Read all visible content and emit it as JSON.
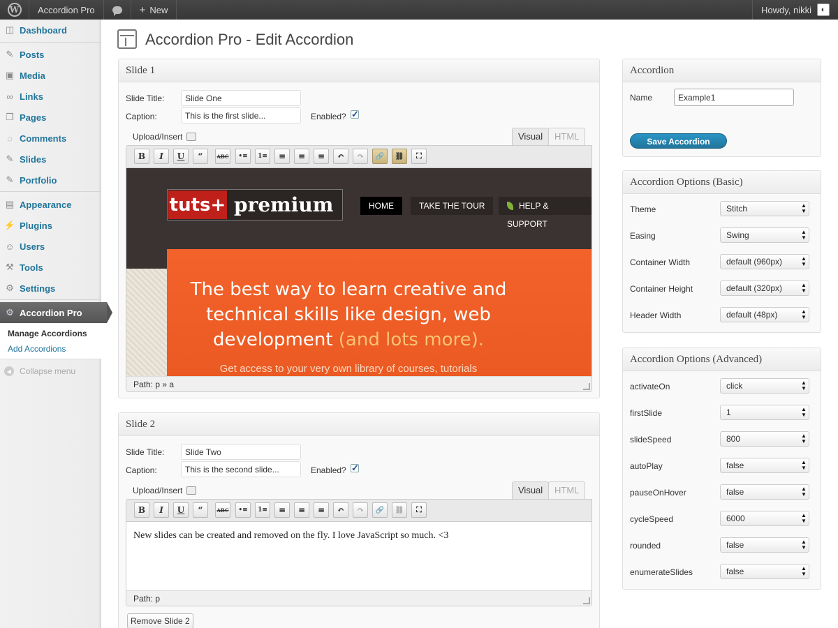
{
  "admin_bar": {
    "site_name": "Accordion Pro",
    "new_label": "New",
    "howdy": "Howdy, nikki"
  },
  "sidebar": {
    "items": [
      {
        "label": "Dashboard",
        "icon": "dashboard-icon"
      },
      {
        "label": "Posts",
        "icon": "pin-icon"
      },
      {
        "label": "Media",
        "icon": "media-icon"
      },
      {
        "label": "Links",
        "icon": "links-icon"
      },
      {
        "label": "Pages",
        "icon": "pages-icon"
      },
      {
        "label": "Comments",
        "icon": "comments-icon"
      },
      {
        "label": "Slides",
        "icon": "pin-icon"
      },
      {
        "label": "Portfolio",
        "icon": "pin-icon"
      },
      {
        "label": "Appearance",
        "icon": "appearance-icon"
      },
      {
        "label": "Plugins",
        "icon": "plugins-icon"
      },
      {
        "label": "Users",
        "icon": "users-icon"
      },
      {
        "label": "Tools",
        "icon": "tools-icon"
      },
      {
        "label": "Settings",
        "icon": "settings-icon"
      },
      {
        "label": "Accordion Pro",
        "icon": "gear-icon"
      }
    ],
    "submenu": [
      "Manage Accordions",
      "Add Accordions"
    ],
    "collapse": "Collapse menu"
  },
  "page": {
    "title": "Accordion Pro - Edit Accordion"
  },
  "slides": [
    {
      "heading": "Slide 1",
      "title_label": "Slide Title:",
      "title_value": "Slide One",
      "caption_label": "Caption:",
      "caption_value": "This is the first slide...",
      "enabled_label": "Enabled?",
      "upload_label": "Upload/Insert",
      "tab_visual": "Visual",
      "tab_html": "HTML",
      "path": "Path: p » a",
      "preview": {
        "logo_left": "tuts+",
        "logo_right": "premium",
        "nav": [
          "HOME",
          "TAKE THE TOUR",
          "HELP & SUPPORT"
        ],
        "headline_1": "The best way to learn creative and",
        "headline_2": "technical skills like design, web",
        "headline_3": "development",
        "headline_highlight": "(and lots more).",
        "subline": "Get access to your very own library of courses, tutorials"
      }
    },
    {
      "heading": "Slide 2",
      "title_label": "Slide Title:",
      "title_value": "Slide Two",
      "caption_label": "Caption:",
      "caption_value": "This is the second slide...",
      "enabled_label": "Enabled?",
      "upload_label": "Upload/Insert",
      "tab_visual": "Visual",
      "tab_html": "HTML",
      "body_text": "New slides can be created and removed on the fly.  I love JavaScript so much. <3",
      "path": "Path: p",
      "remove_label": "Remove Slide 2"
    }
  ],
  "toolbar_buttons": [
    "B",
    "I",
    "U",
    "“",
    "ABC",
    "•≡",
    "1≡",
    "≡",
    "≡",
    "≡",
    "↶",
    "↷",
    "🔗",
    "⛓",
    "⛶"
  ],
  "accordion_box": {
    "heading": "Accordion",
    "name_label": "Name",
    "name_value": "Example1",
    "save_label": "Save Accordion"
  },
  "basic_options": {
    "heading": "Accordion Options (Basic)",
    "rows": [
      {
        "label": "Theme",
        "value": "Stitch"
      },
      {
        "label": "Easing",
        "value": "Swing"
      },
      {
        "label": "Container Width",
        "value": "default (960px)"
      },
      {
        "label": "Container Height",
        "value": "default (320px)"
      },
      {
        "label": "Header Width",
        "value": "default (48px)"
      }
    ]
  },
  "advanced_options": {
    "heading": "Accordion Options (Advanced)",
    "rows": [
      {
        "label": "activateOn",
        "value": "click"
      },
      {
        "label": "firstSlide",
        "value": "1"
      },
      {
        "label": "slideSpeed",
        "value": "800"
      },
      {
        "label": "autoPlay",
        "value": "false"
      },
      {
        "label": "pauseOnHover",
        "value": "false"
      },
      {
        "label": "cycleSpeed",
        "value": "6000"
      },
      {
        "label": "rounded",
        "value": "false"
      },
      {
        "label": "enumerateSlides",
        "value": "false"
      }
    ]
  },
  "colors": {
    "link_blue": "#21759b",
    "admin_bar": "#464646",
    "hero_orange": "#f2622a"
  }
}
